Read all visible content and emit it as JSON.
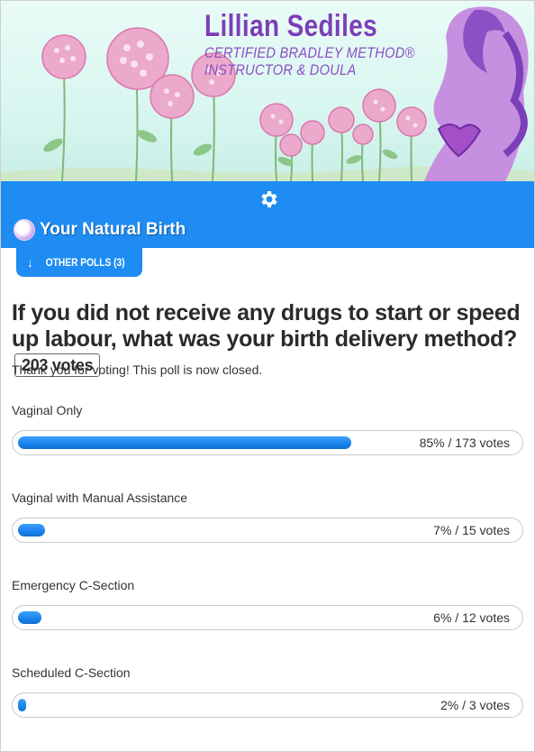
{
  "banner": {
    "name": "Lillian Sediles",
    "line1": "CERTIFIED BRADLEY METHOD®",
    "line2": "INSTRUCTOR & DOULA"
  },
  "poll_brand": {
    "title": "Your Natural Birth",
    "settings_icon": "gear-icon"
  },
  "other_polls": {
    "label": "OTHER POLLS (3)",
    "icon": "arrow-down-icon"
  },
  "question": {
    "text": "If you did not receive any drugs to start or speed up labour, what was your birth delivery method?",
    "total_votes": "203 votes",
    "status": "Thank you for voting! This poll is now closed."
  },
  "answers": [
    {
      "label": "Vaginal Only",
      "result": "85% / 173 votes",
      "percent": 85
    },
    {
      "label": "Vaginal with Manual Assistance",
      "result": "7% / 15 votes",
      "percent": 7
    },
    {
      "label": "Emergency C-Section",
      "result": "6% / 12 votes",
      "percent": 6
    },
    {
      "label": "Scheduled C-Section",
      "result": "2% / 3 votes",
      "percent": 2
    }
  ],
  "colors": {
    "accent": "#1e8cf2",
    "brand_purple": "#7b3fb8",
    "flower_pink": "#e89bc4"
  }
}
